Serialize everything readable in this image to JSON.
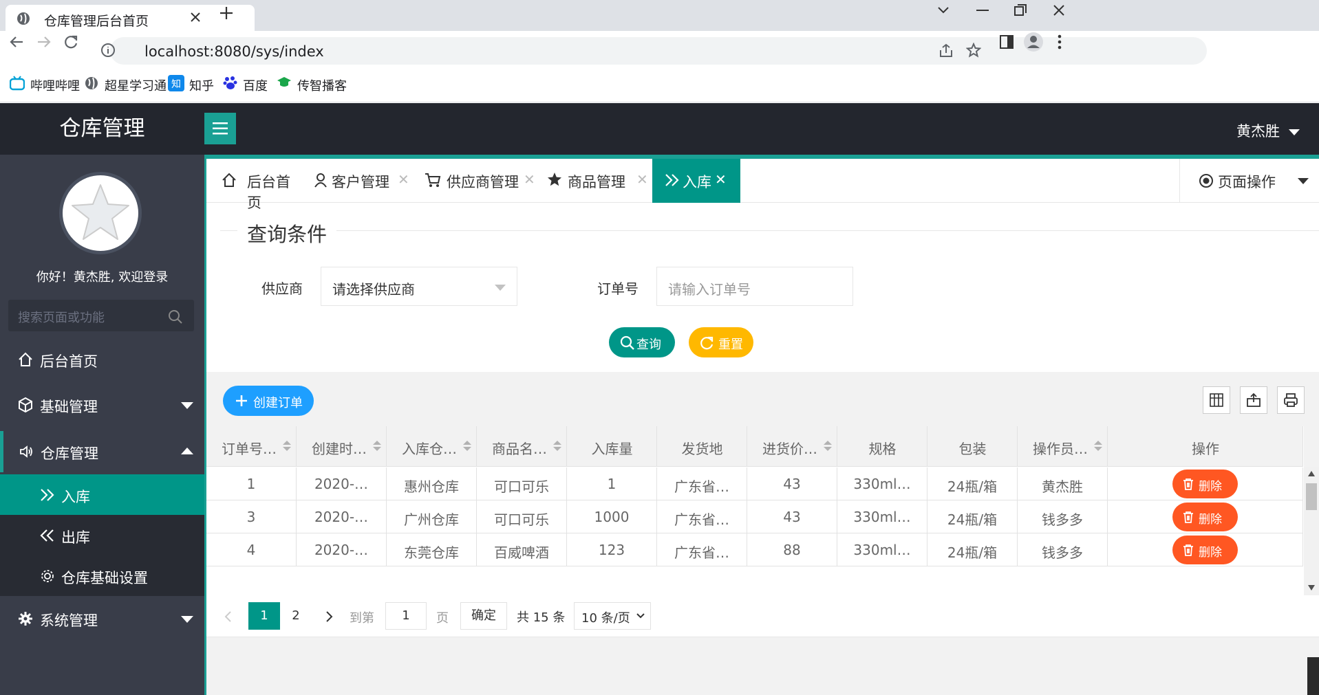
{
  "browser": {
    "tab_title": "仓库管理后台首页",
    "url": "localhost:8080/sys/index",
    "bookmarks": [
      "哔哩哔哩",
      "超星学习通",
      "知乎",
      "百度",
      "传智播客"
    ]
  },
  "app": {
    "logo": "仓库管理",
    "user": "黄杰胜"
  },
  "sidebar": {
    "welcome": "你好！黄杰胜, 欢迎登录",
    "search_placeholder": "搜索页面或功能",
    "items": [
      {
        "label": "后台首页",
        "icon": "home-icon"
      },
      {
        "label": "基础管理",
        "icon": "cube-icon"
      },
      {
        "label": "仓库管理",
        "icon": "speaker-icon"
      },
      {
        "label": "系统管理",
        "icon": "gear-icon"
      }
    ],
    "sub_items": [
      {
        "label": "入库",
        "icon": "double-right-icon",
        "active": true
      },
      {
        "label": "出库",
        "icon": "double-left-icon"
      },
      {
        "label": "仓库基础设置",
        "icon": "gear-icon"
      }
    ]
  },
  "tabs": [
    {
      "label": "后台首页",
      "icon": "home-icon"
    },
    {
      "label": "客户管理",
      "icon": "user-icon"
    },
    {
      "label": "供应商管理",
      "icon": "cart-icon"
    },
    {
      "label": "商品管理",
      "icon": "star-icon"
    },
    {
      "label": "入库",
      "icon": "double-right-icon",
      "active": true
    }
  ],
  "page_ops": "页面操作",
  "query": {
    "legend": "查询条件",
    "supplier_label": "供应商",
    "supplier_value": "请选择供应商",
    "order_label": "订单号",
    "order_placeholder": "请输入订单号",
    "search_btn": "查询",
    "reset_btn": "重置"
  },
  "table": {
    "create_btn": "创建订单",
    "headers": [
      "订单号…",
      "创建时…",
      "入库仓…",
      "商品名…",
      "入库量",
      "发货地",
      "进货价…",
      "规格",
      "包装",
      "操作员…",
      "操作"
    ],
    "rows": [
      [
        "1",
        "2020-…",
        "惠州仓库",
        "可口可乐",
        "1",
        "广东省…",
        "43",
        "330ml…",
        "24瓶/箱",
        "黄杰胜"
      ],
      [
        "3",
        "2020-…",
        "广州仓库",
        "可口可乐",
        "1000",
        "广东省…",
        "43",
        "330ml…",
        "24瓶/箱",
        "钱多多"
      ],
      [
        "4",
        "2020-…",
        "东莞仓库",
        "百威啤酒",
        "123",
        "广东省…",
        "88",
        "330ml…",
        "24瓶/箱",
        "钱多多"
      ]
    ],
    "delete_label": "删除"
  },
  "pager": {
    "pages": [
      "1",
      "2"
    ],
    "current": "1",
    "goto_label": "到第",
    "goto_value": "1",
    "page_unit": "页",
    "confirm": "确定",
    "total": "共 15 条",
    "per_page": "10 条/页"
  }
}
